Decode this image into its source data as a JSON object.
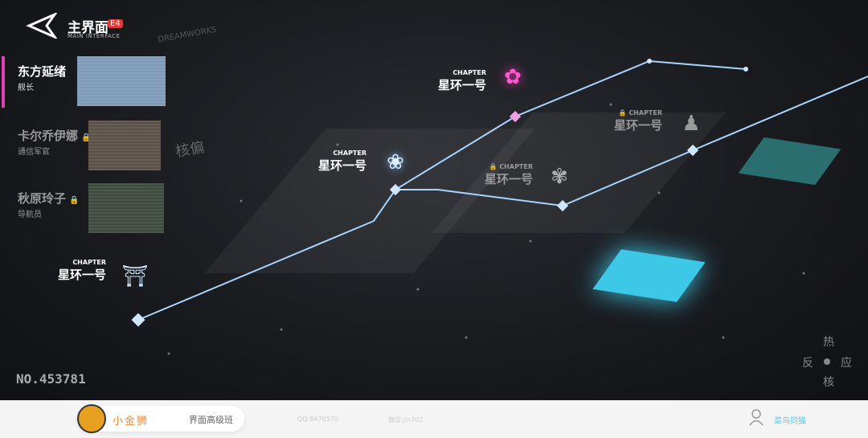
{
  "header": {
    "title": "主界面",
    "badge": "E4",
    "subtitle": "MAIN INTERFACE"
  },
  "crew": [
    {
      "name": "东方延绪",
      "role": "舰长",
      "locked": false
    },
    {
      "name": "卡尔乔伊娜",
      "role": "通信军官",
      "locked": true
    },
    {
      "name": "秋原玲子",
      "role": "导航员",
      "locked": true
    }
  ],
  "chapters": [
    {
      "tag": "CHAPTER",
      "name": "星环一号",
      "icon": "gate-icon",
      "locked": false
    },
    {
      "tag": "CHAPTER",
      "name": "星环一号",
      "icon": "lotus-icon",
      "locked": false
    },
    {
      "tag": "CHAPTER",
      "name": "星环一号",
      "icon": "pink-lotus-icon",
      "locked": false
    },
    {
      "tag": "CHAPTER",
      "name": "星环一号",
      "icon": "flower-seal-icon",
      "locked": true
    },
    {
      "tag": "CHAPTER",
      "name": "星环一号",
      "icon": "buddha-icon",
      "locked": true
    }
  ],
  "bg_text": {
    "brand": "DREAMWORKS",
    "core": "核偏"
  },
  "serial": "NO.453781",
  "seal": {
    "top": "热",
    "left": "反",
    "right": "应",
    "bottom": "核"
  },
  "footer": {
    "brand": "小金狮",
    "course": "界面高级班",
    "qq": "QQ:8470570",
    "wechat": "微信:jin702",
    "user": "菜鸟同猫"
  },
  "colors": {
    "accent": "#e040b0",
    "line": "#a8d4ff",
    "cyan": "#3ec8e8"
  }
}
